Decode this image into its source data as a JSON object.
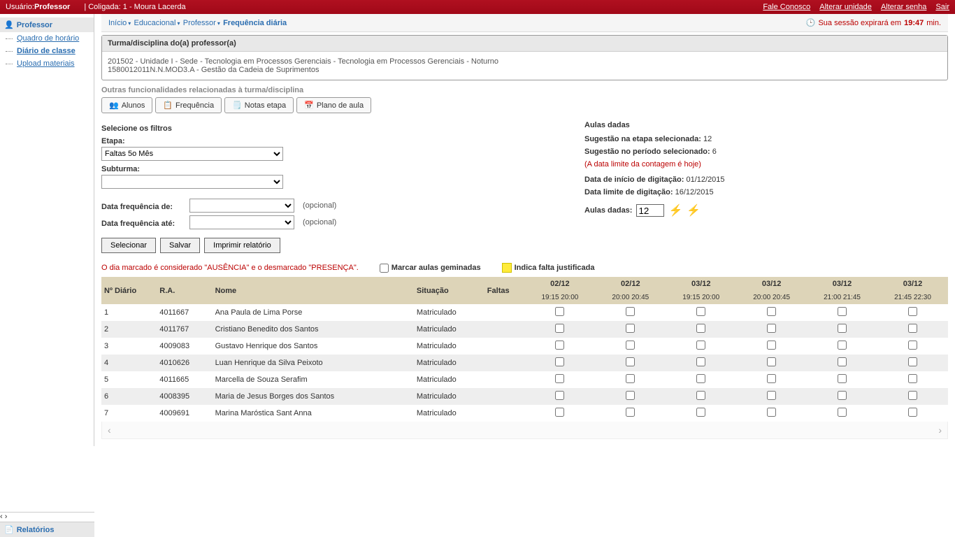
{
  "topbar": {
    "user_label": "Usuário:",
    "user_value": "Professor",
    "coligada": "| Coligada: 1 - Moura Lacerda",
    "links": {
      "fale": "Fale Conosco",
      "unidade": "Alterar unidade",
      "senha": "Alterar senha",
      "sair": "Sair"
    }
  },
  "breadcrumb": {
    "items": [
      "Início",
      "Educacional",
      "Professor",
      "Frequência diária"
    ],
    "session_label": "Sua sessão expirará em",
    "session_time": "19:47",
    "session_unit": "min."
  },
  "sidebar": {
    "header": "Professor",
    "items": [
      {
        "label": "Quadro de horário",
        "active": false
      },
      {
        "label": "Diário de classe",
        "active": true
      },
      {
        "label": "Upload materiais",
        "active": false
      }
    ],
    "footer": "Relatórios"
  },
  "panel": {
    "title": "Turma/disciplina do(a) professor(a)",
    "line1": "201502 - Unidade I - Sede - Tecnologia em Processos Gerenciais - Tecnologia em Processos Gerenciais - Noturno",
    "line2": "1580012011N.N.MOD3.A - Gestão da Cadeia de Suprimentos"
  },
  "subheader": "Outras funcionalidades relacionadas à turma/disciplina",
  "tabs": {
    "alunos": "Alunos",
    "freq": "Frequência",
    "notas": "Notas etapa",
    "plano": "Plano de aula"
  },
  "filters": {
    "title": "Selecione os filtros",
    "etapa_label": "Etapa:",
    "etapa_value": "Faltas 5o Mês",
    "subturma_label": "Subturma:",
    "subturma_value": "",
    "date_from_label": "Data frequência de:",
    "date_to_label": "Data frequência até:",
    "optional": "(opcional)",
    "buttons": {
      "select": "Selecionar",
      "save": "Salvar",
      "print": "Imprimir relatório"
    }
  },
  "aulas": {
    "title": "Aulas dadas",
    "sug_etapa_label": "Sugestão na etapa selecionada:",
    "sug_etapa_val": "12",
    "sug_periodo_label": "Sugestão no período selecionado:",
    "sug_periodo_val": "6",
    "note": "(A data limite da contagem é hoje)",
    "inicio_label": "Data de início de digitação:",
    "inicio_val": "01/12/2015",
    "limite_label": "Data limite de digitação:",
    "limite_val": "16/12/2015",
    "dadas_label": "Aulas dadas:",
    "dadas_val": "12"
  },
  "notice": {
    "red": "O dia marcado é considerado \"AUSÊNCIA\" e o desmarcado \"PRESENÇA\".",
    "geminadas": "Marcar aulas geminadas",
    "justificada": "Indica falta justificada"
  },
  "grid": {
    "headers": {
      "num": "Nº Diário",
      "ra": "R.A.",
      "nome": "Nome",
      "sit": "Situação",
      "faltas": "Faltas"
    },
    "dates": [
      "02/12",
      "02/12",
      "03/12",
      "03/12",
      "03/12",
      "03/12"
    ],
    "times": [
      "19:15 20:00",
      "20:00 20:45",
      "19:15 20:00",
      "20:00 20:45",
      "21:00 21:45",
      "21:45 22:30"
    ],
    "rows": [
      {
        "n": "1",
        "ra": "4011667",
        "nome": "Ana Paula de Lima Porse",
        "sit": "Matriculado"
      },
      {
        "n": "2",
        "ra": "4011767",
        "nome": "Cristiano Benedito dos Santos",
        "sit": "Matriculado"
      },
      {
        "n": "3",
        "ra": "4009083",
        "nome": "Gustavo Henrique dos Santos",
        "sit": "Matriculado"
      },
      {
        "n": "4",
        "ra": "4010626",
        "nome": "Luan Henrique da Silva Peixoto",
        "sit": "Matriculado"
      },
      {
        "n": "5",
        "ra": "4011665",
        "nome": "Marcella de Souza Serafim",
        "sit": "Matriculado"
      },
      {
        "n": "6",
        "ra": "4008395",
        "nome": "Maria de Jesus Borges dos Santos",
        "sit": "Matriculado"
      },
      {
        "n": "7",
        "ra": "4009691",
        "nome": "Marina Maróstica Sant Anna",
        "sit": "Matriculado"
      }
    ]
  }
}
